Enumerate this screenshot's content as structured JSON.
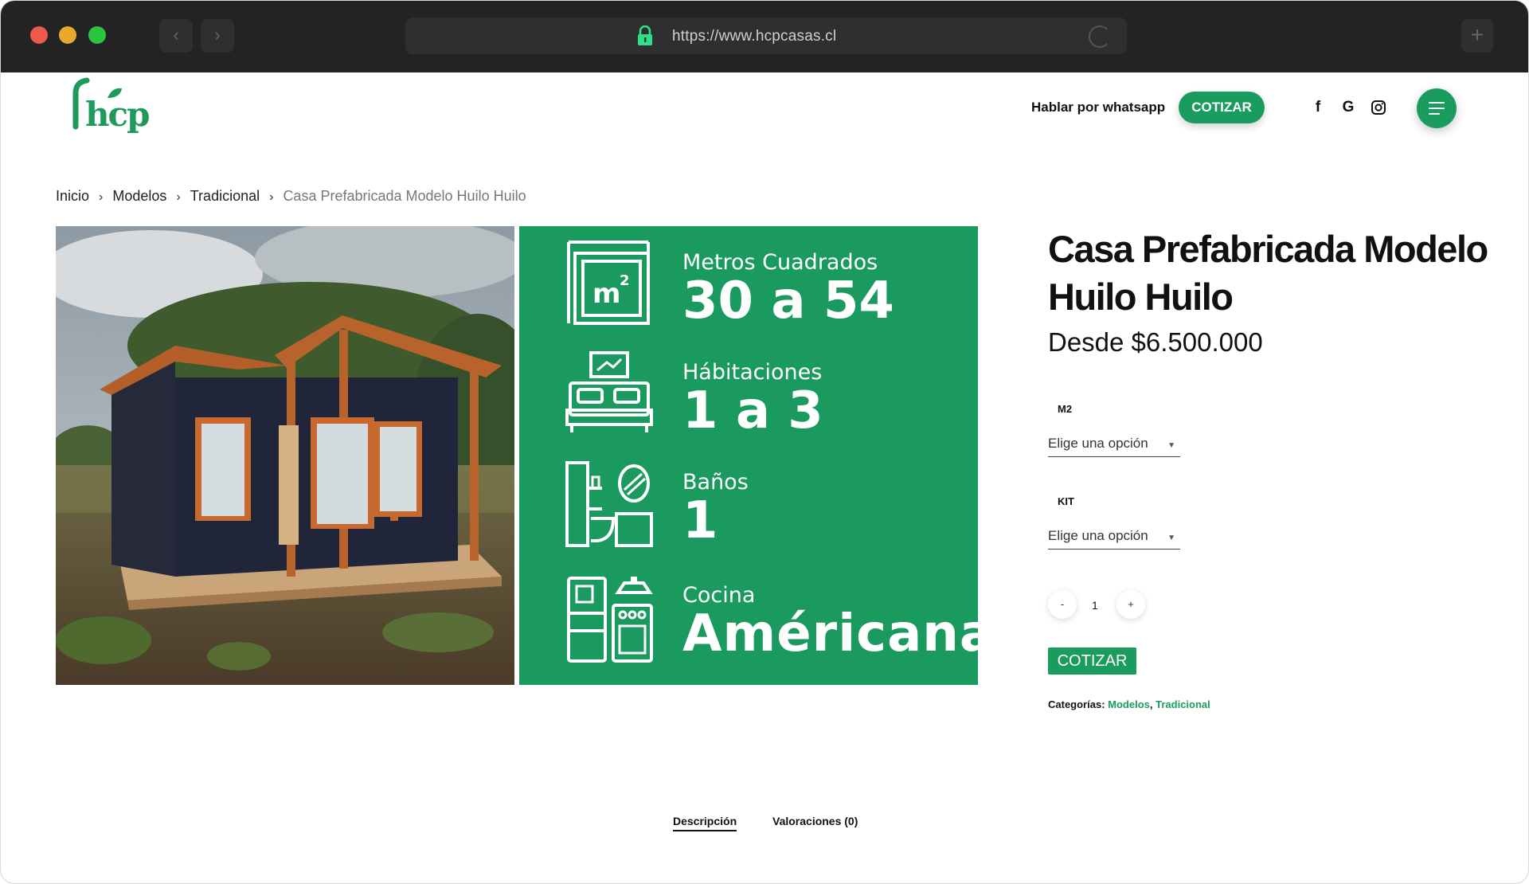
{
  "browser": {
    "url": "https://www.hcpcasas.cl"
  },
  "header": {
    "logo_text": "hcp",
    "whatsapp_link": "Hablar por whatsapp",
    "cotizar_button": "COTIZAR",
    "social_icons": [
      "facebook-icon",
      "google-icon",
      "instagram-icon"
    ]
  },
  "breadcrumb": {
    "items": [
      "Inicio",
      "Modelos",
      "Tradicional"
    ],
    "current": "Casa Prefabricada Modelo Huilo Huilo"
  },
  "infocard": {
    "rows": [
      {
        "label": "Metros Cuadrados",
        "value": "30 a 54",
        "icon": "square-meters-icon"
      },
      {
        "label": "Hábitaciones",
        "value": "1 a 3",
        "icon": "bed-icon"
      },
      {
        "label": "Baños",
        "value": "1",
        "icon": "bathroom-icon"
      },
      {
        "label": "Cocina",
        "value": "Américana",
        "icon": "kitchen-icon"
      }
    ]
  },
  "product": {
    "title": "Casa Prefabricada Modelo Huilo Huilo",
    "price": "Desde $6.500.000",
    "attributes": [
      {
        "label": "M2",
        "selected": "Elige una opción"
      },
      {
        "label": "KIT",
        "selected": "Elige una opción"
      }
    ],
    "quantity": {
      "minus": "-",
      "value": "1",
      "plus": "+"
    },
    "add_button": "COTIZAR",
    "categories_label": "Categorías:",
    "categories": [
      "Modelos",
      "Tradicional"
    ],
    "categories_sep": ","
  },
  "tabs": [
    {
      "label": "Descripción",
      "active": true
    },
    {
      "label": "Valoraciones (0)",
      "active": false
    }
  ],
  "colors": {
    "brand_green": "#1a9c5f",
    "chrome_bg": "#232323"
  }
}
